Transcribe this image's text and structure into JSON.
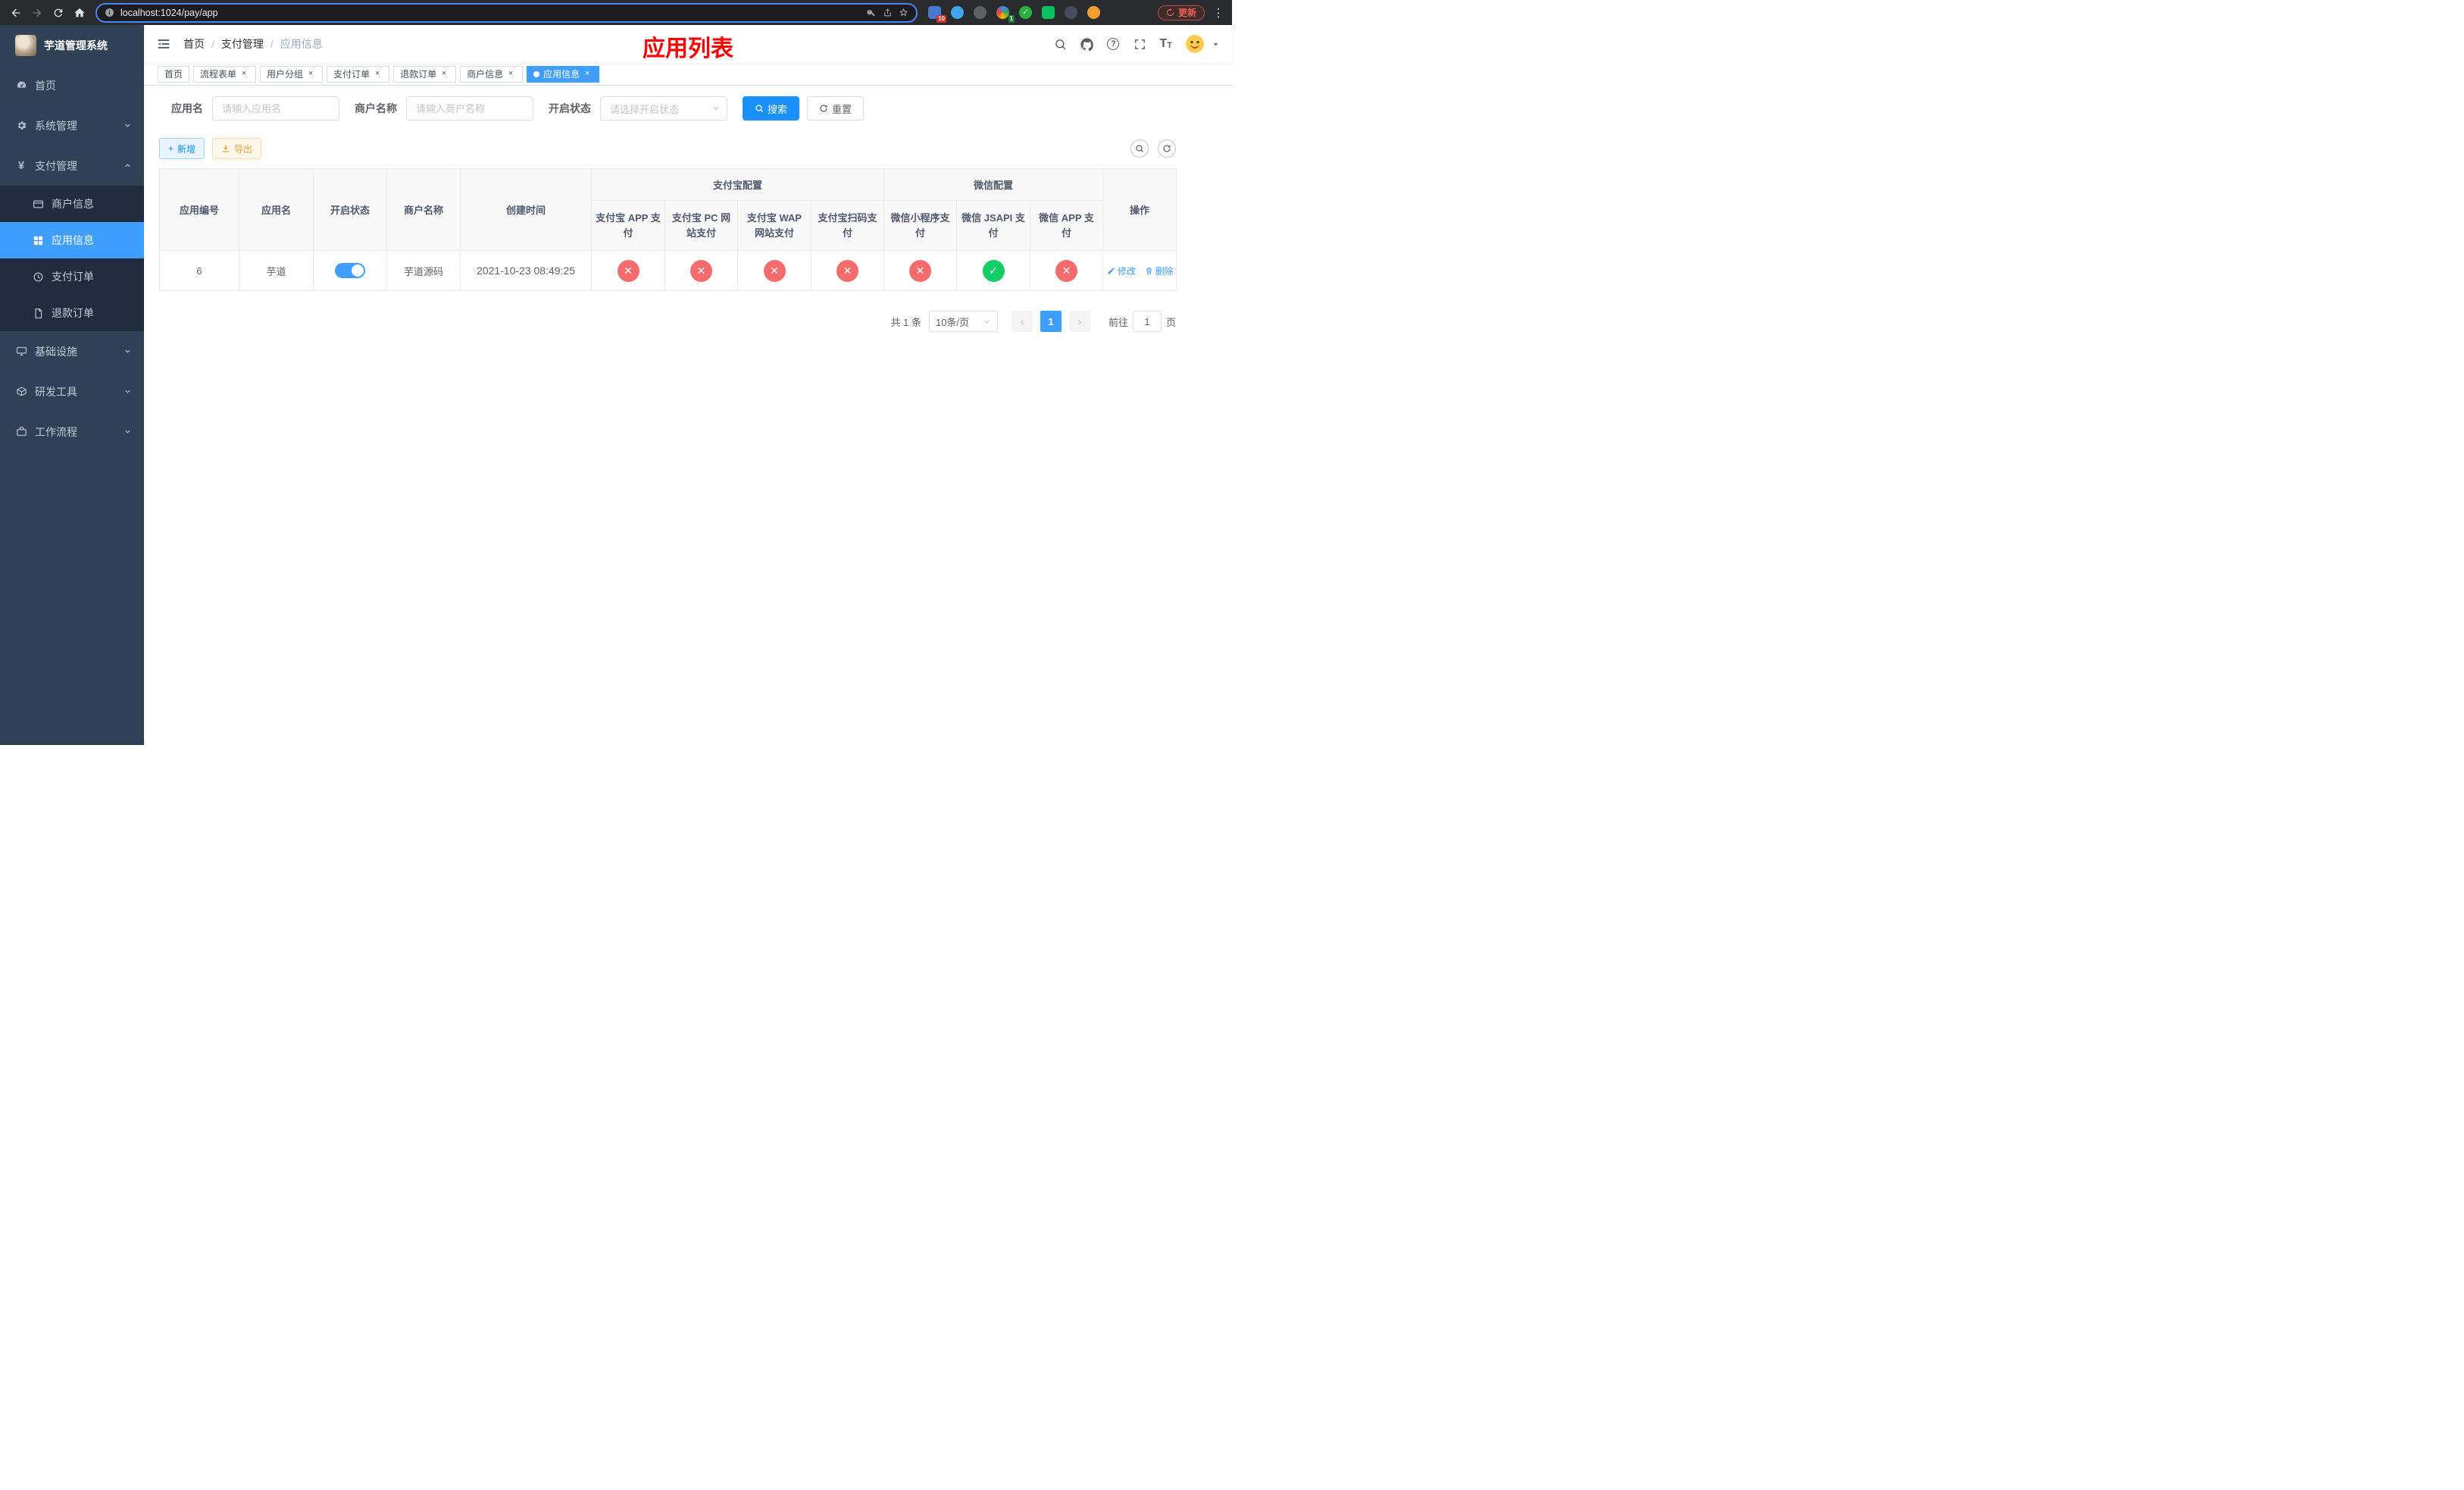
{
  "colors": {
    "accent": "#409EFF",
    "primary_button": "#1890ff",
    "danger": "#f56c6c",
    "success": "#13ce66",
    "title_red": "#ff0000",
    "sidebar_bg": "#304156",
    "submenu_bg": "#1f2d3d"
  },
  "icons": {
    "close": "×",
    "check": "✓",
    "cross": "✕",
    "plus": "+",
    "prev": "‹",
    "next": "›",
    "dots": "⋮",
    "question": "?",
    "yen": "¥",
    "font_size": "T",
    "sep": "/"
  },
  "browser": {
    "url": "localhost:1024/pay/app",
    "update_label": "更新",
    "badge_first": "10",
    "badge_second": "1"
  },
  "sidebar": {
    "title": "芋道管理系统",
    "items": [
      {
        "label": "首页"
      },
      {
        "label": "系统管理"
      },
      {
        "label": "支付管理"
      },
      {
        "label": "基础设施"
      },
      {
        "label": "研发工具"
      },
      {
        "label": "工作流程"
      }
    ],
    "payment_children": [
      {
        "label": "商户信息"
      },
      {
        "label": "应用信息"
      },
      {
        "label": "支付订单"
      },
      {
        "label": "退款订单"
      }
    ]
  },
  "header": {
    "breadcrumb": [
      "首页",
      "支付管理",
      "应用信息"
    ],
    "page_title": "应用列表"
  },
  "tags": [
    {
      "label": "首页"
    },
    {
      "label": "流程表单"
    },
    {
      "label": "用户分组"
    },
    {
      "label": "支付订单"
    },
    {
      "label": "退款订单"
    },
    {
      "label": "商户信息"
    },
    {
      "label": "应用信息"
    }
  ],
  "filters": {
    "app_name_label": "应用名",
    "app_name_placeholder": "请输入应用名",
    "merchant_label": "商户名称",
    "merchant_placeholder": "请输入商户名称",
    "status_label": "开启状态",
    "status_placeholder": "请选择开启状态",
    "search_label": "搜索",
    "reset_label": "重置"
  },
  "toolbar": {
    "add_label": "新增",
    "export_label": "导出"
  },
  "table": {
    "headers": {
      "app_id": "应用编号",
      "app_name": "应用名",
      "status": "开启状态",
      "merchant": "商户名称",
      "create_time": "创建时间",
      "alipay_group": "支付宝配置",
      "wechat_group": "微信配置",
      "actions": "操作",
      "alipay_app": "支付宝 APP 支付",
      "alipay_pc": "支付宝 PC 网站支付",
      "alipay_wap": "支付宝 WAP 网站支付",
      "alipay_qr": "支付宝扫码支付",
      "wechat_mini": "微信小程序支付",
      "wechat_jsapi": "微信 JSAPI 支付",
      "wechat_app": "微信 APP 支付"
    },
    "row": {
      "app_id": "6",
      "app_name": "芋道",
      "status_on": true,
      "merchant": "芋道源码",
      "create_time": "2021-10-23 08:49:25",
      "config": {
        "alipay_app": false,
        "alipay_pc": false,
        "alipay_wap": false,
        "alipay_qr": false,
        "wechat_mini": false,
        "wechat_jsapi": true,
        "wechat_app": false
      },
      "edit_label": "修改",
      "delete_label": "删除"
    }
  },
  "pagination": {
    "total_label": "共 1 条",
    "page_size_label": "10条/页",
    "current_page": "1",
    "goto_label": "前往",
    "goto_value": "1",
    "page_unit": "页"
  }
}
